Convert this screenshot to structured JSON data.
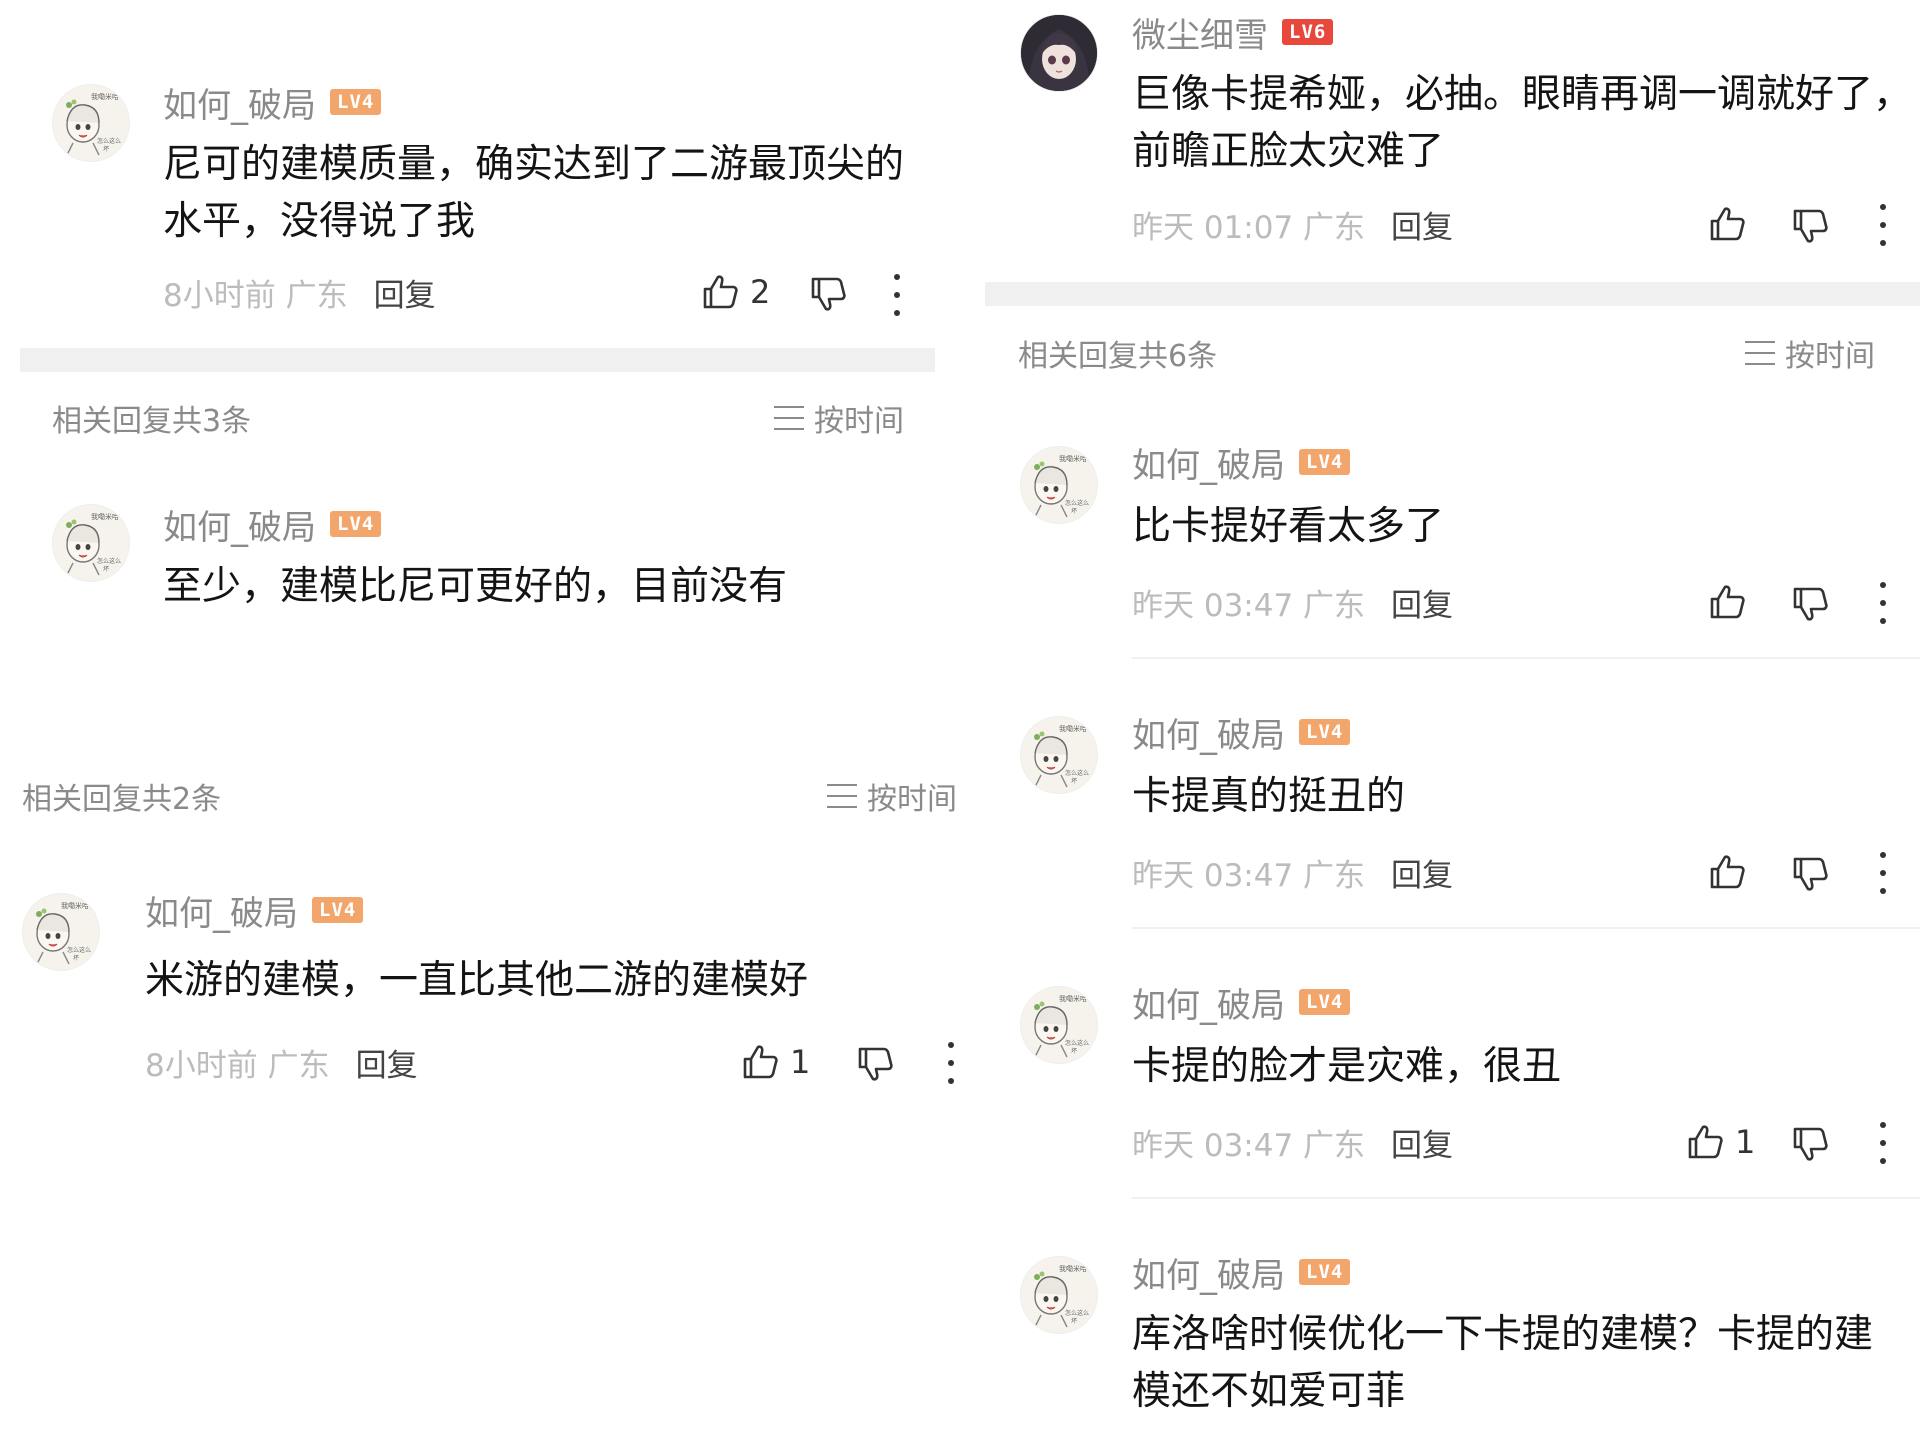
{
  "left": {
    "top_comment": {
      "user": "如何_破局",
      "level": "LV4",
      "text_line1": "尼可的建模质量，确实达到了二游最顶尖的",
      "text_line2": "水平，没得说了我",
      "time": "8小时前 广东",
      "reply": "回复",
      "likes": "2"
    },
    "section1": {
      "title": "相关回复共3条",
      "sort": "按时间"
    },
    "reply1": {
      "user": "如何_破局",
      "level": "LV4",
      "text": "至少，建模比尼可更好的，目前没有"
    },
    "section2": {
      "title": "相关回复共2条",
      "sort": "按时间"
    },
    "reply2": {
      "user": "如何_破局",
      "level": "LV4",
      "text": "米游的建模，一直比其他二游的建模好",
      "time": "8小时前 广东",
      "reply": "回复",
      "likes": "1"
    }
  },
  "right": {
    "top_comment": {
      "user": "微尘细雪",
      "level": "LV6",
      "text_line1": "巨像卡提希娅，必抽。眼睛再调一调就好了，",
      "text_line2": "前瞻正脸太灾难了",
      "time": "昨天 01:07 广东",
      "reply": "回复"
    },
    "section": {
      "title": "相关回复共6条",
      "sort": "按时间"
    },
    "replies": [
      {
        "user": "如何_破局",
        "level": "LV4",
        "text": "比卡提好看太多了",
        "time": "昨天 03:47 广东",
        "reply": "回复"
      },
      {
        "user": "如何_破局",
        "level": "LV4",
        "text": "卡提真的挺丑的",
        "time": "昨天 03:47 广东",
        "reply": "回复"
      },
      {
        "user": "如何_破局",
        "level": "LV4",
        "text": "卡提的脸才是灾难，很丑",
        "time": "昨天 03:47 广东",
        "reply": "回复",
        "likes": "1"
      },
      {
        "user": "如何_破局",
        "level": "LV4",
        "text_line1": "库洛啥时候优化一下卡提的建模？卡提的建",
        "text_line2": "模还不如爱可菲"
      }
    ]
  },
  "icons": [
    "thumb-up-icon",
    "thumb-down-icon",
    "more-vertical-icon",
    "sort-list-icon"
  ],
  "colors": {
    "level_badge": "#f3a66b",
    "level_badge_high": "#e8473c",
    "muted_text": "#8a8a8a",
    "meta_text": "#bcbcbc",
    "divider": "#f0f0f0"
  }
}
